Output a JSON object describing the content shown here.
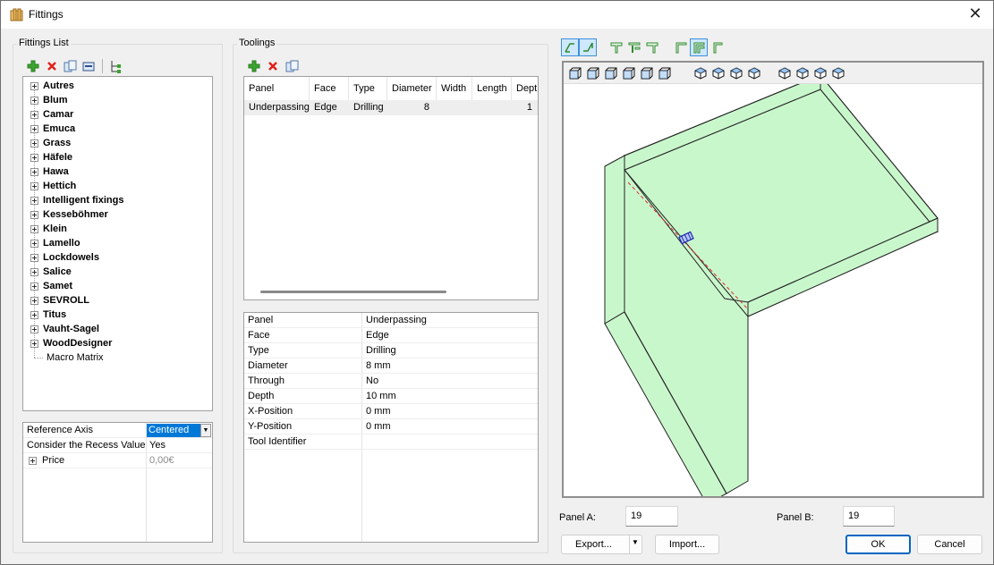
{
  "window": {
    "title": "Fittings",
    "close_glyph": "✕"
  },
  "fittings_list": {
    "label": "Fittings List",
    "toolbar": [
      "add-icon",
      "delete-icon",
      "copy-icon",
      "edit-icon",
      "tree-structure-icon"
    ],
    "items": [
      "Autres",
      "Blum",
      "Camar",
      "Emuca",
      "Grass",
      "Häfele",
      "Hawa",
      "Hettich",
      "Intelligent fixings",
      "Kesseböhmer",
      "Klein",
      "Lamello",
      "Lockdowels",
      "Salice",
      "Samet",
      "SEVROLL",
      "Titus",
      "Vauht-Sagel",
      "WoodDesigner"
    ],
    "leaf_item": "Macro Matrix"
  },
  "properties": {
    "reference_axis_label": "Reference Axis",
    "reference_axis_value": "Centered",
    "recess_label": "Consider the Recess Value",
    "recess_value": "Yes",
    "price_label": "Price",
    "price_value": "0,00€"
  },
  "toolings": {
    "label": "Toolings",
    "toolbar": [
      "add-icon",
      "delete-icon",
      "copy-icon"
    ],
    "columns": [
      "Panel",
      "Face",
      "Type",
      "Diameter",
      "Width",
      "Length",
      "Dept"
    ],
    "rows": [
      [
        "Underpassing",
        "Edge",
        "Drilling",
        "8",
        "",
        "",
        "1"
      ]
    ],
    "details": [
      {
        "name": "Panel",
        "value": "Underpassing"
      },
      {
        "name": "Face",
        "value": "Edge"
      },
      {
        "name": "Type",
        "value": "Drilling"
      },
      {
        "name": "Diameter",
        "value": "8 mm"
      },
      {
        "name": "Through",
        "value": "No"
      },
      {
        "name": "Depth",
        "value": "10 mm"
      },
      {
        "name": "X-Position",
        "value": "0 mm"
      },
      {
        "name": "Y-Position",
        "value": "0 mm"
      },
      {
        "name": "Tool Identifier",
        "value": ""
      }
    ]
  },
  "preview": {
    "panel_a_label": "Panel A:",
    "panel_a_value": "19",
    "panel_b_label": "Panel B:",
    "panel_b_value": "19",
    "panel_color": "#c9f7cc"
  },
  "buttons": {
    "export": "Export...",
    "import": "Import...",
    "ok": "OK",
    "cancel": "Cancel"
  }
}
